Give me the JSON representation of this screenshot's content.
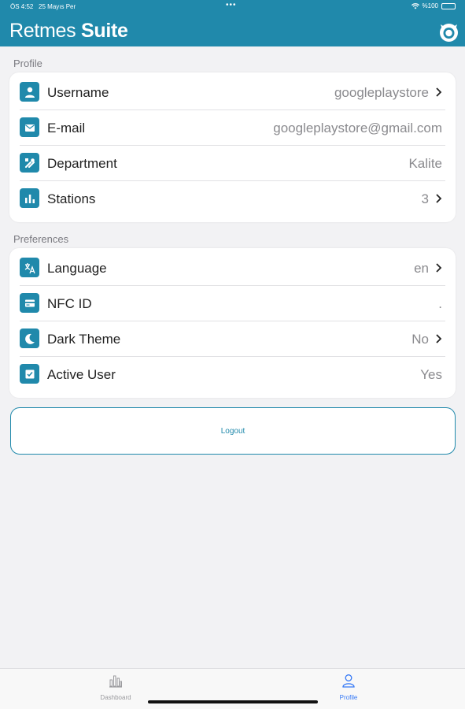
{
  "status_bar": {
    "time": "ÖS 4:52",
    "date": "25 Mayıs Per",
    "dots": "•••",
    "battery": "%100"
  },
  "header": {
    "title_light": "Retmes",
    "title_bold": "Suite"
  },
  "profile_section": {
    "label": "Profile",
    "rows": [
      {
        "label": "Username",
        "value": "googleplaystore",
        "icon": "person-icon",
        "chevron": true
      },
      {
        "label": "E-mail",
        "value": "googleplaystore@gmail.com",
        "icon": "mail-icon",
        "chevron": false
      },
      {
        "label": "Department",
        "value": "Kalite",
        "icon": "tools-icon",
        "chevron": false
      },
      {
        "label": "Stations",
        "value": "3",
        "icon": "bar-chart-icon",
        "chevron": true
      }
    ]
  },
  "preferences_section": {
    "label": "Preferences",
    "rows": [
      {
        "label": "Language",
        "value": "en",
        "icon": "translate-icon",
        "chevron": true
      },
      {
        "label": "NFC ID",
        "value": ".",
        "icon": "card-icon",
        "chevron": false
      },
      {
        "label": "Dark Theme",
        "value": "No",
        "icon": "moon-icon",
        "chevron": true
      },
      {
        "label": "Active User",
        "value": "Yes",
        "icon": "check-box-icon",
        "chevron": false
      }
    ]
  },
  "logout_label": "Logout",
  "tabbar": {
    "tabs": [
      {
        "label": "Dashboard",
        "icon": "dashboard-icon",
        "active": false
      },
      {
        "label": "Profile",
        "icon": "profile-icon",
        "active": true
      }
    ]
  },
  "colors": {
    "brand": "#2089ab",
    "active_tab": "#3478f6",
    "inactive_tab": "#9a9a9e"
  }
}
